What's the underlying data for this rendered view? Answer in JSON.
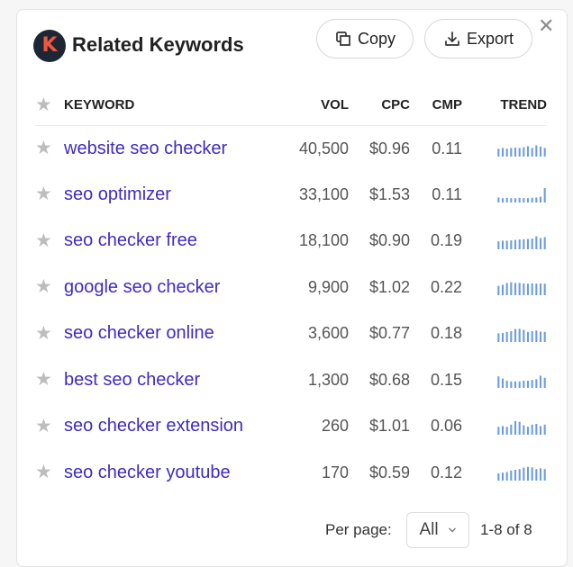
{
  "header": {
    "logo_letter": "K",
    "title": "Related Keywords",
    "copy_label": "Copy",
    "export_label": "Export",
    "close_glyph": "✕"
  },
  "table": {
    "columns": {
      "keyword": "KEYWORD",
      "vol": "VOL",
      "cpc": "CPC",
      "cmp": "CMP",
      "trend": "TREND"
    },
    "rows": [
      {
        "keyword": "website seo checker",
        "vol": "40,500",
        "cpc": "$0.96",
        "cmp": "0.11",
        "trend": [
          0.55,
          0.6,
          0.55,
          0.6,
          0.62,
          0.6,
          0.65,
          0.72,
          0.6,
          0.78,
          0.7,
          0.6
        ]
      },
      {
        "keyword": "seo optimizer",
        "vol": "33,100",
        "cpc": "$1.53",
        "cmp": "0.11",
        "trend": [
          0.35,
          0.3,
          0.32,
          0.3,
          0.3,
          0.32,
          0.3,
          0.3,
          0.33,
          0.35,
          0.4,
          1.0
        ]
      },
      {
        "keyword": "seo checker free",
        "vol": "18,100",
        "cpc": "$0.90",
        "cmp": "0.19",
        "trend": [
          0.55,
          0.6,
          0.6,
          0.62,
          0.65,
          0.68,
          0.7,
          0.72,
          0.75,
          0.9,
          0.78,
          0.85
        ]
      },
      {
        "keyword": "google seo checker",
        "vol": "9,900",
        "cpc": "$1.02",
        "cmp": "0.22",
        "trend": [
          0.65,
          0.72,
          0.85,
          0.9,
          0.85,
          0.85,
          0.82,
          0.8,
          0.82,
          0.8,
          0.82,
          0.8
        ]
      },
      {
        "keyword": "seo checker online",
        "vol": "3,600",
        "cpc": "$0.77",
        "cmp": "0.18",
        "trend": [
          0.6,
          0.62,
          0.7,
          0.75,
          0.9,
          0.92,
          0.85,
          0.7,
          0.75,
          0.8,
          0.72,
          0.7
        ]
      },
      {
        "keyword": "best seo checker",
        "vol": "1,300",
        "cpc": "$0.68",
        "cmp": "0.15",
        "trend": [
          0.8,
          0.65,
          0.5,
          0.45,
          0.45,
          0.45,
          0.5,
          0.5,
          0.55,
          0.6,
          0.85,
          0.7
        ]
      },
      {
        "keyword": "seo checker extension",
        "vol": "260",
        "cpc": "$1.01",
        "cmp": "0.06",
        "trend": [
          0.55,
          0.6,
          0.55,
          0.7,
          0.95,
          0.9,
          0.65,
          0.55,
          0.7,
          0.75,
          0.6,
          0.7
        ]
      },
      {
        "keyword": "seo checker youtube",
        "vol": "170",
        "cpc": "$0.59",
        "cmp": "0.12",
        "trend": [
          0.5,
          0.55,
          0.6,
          0.7,
          0.75,
          0.8,
          0.9,
          0.95,
          0.92,
          0.8,
          0.85,
          0.8
        ]
      }
    ]
  },
  "pagination": {
    "per_page_label": "Per page:",
    "per_page_value": "All",
    "range_text": "1-8 of 8"
  },
  "colors": {
    "accent": "#3f2cc0",
    "trend_bar": "#6d9de0",
    "logo_bg": "#1d2634",
    "logo_letter": "#f0573f",
    "star": "#bdbdbd"
  }
}
